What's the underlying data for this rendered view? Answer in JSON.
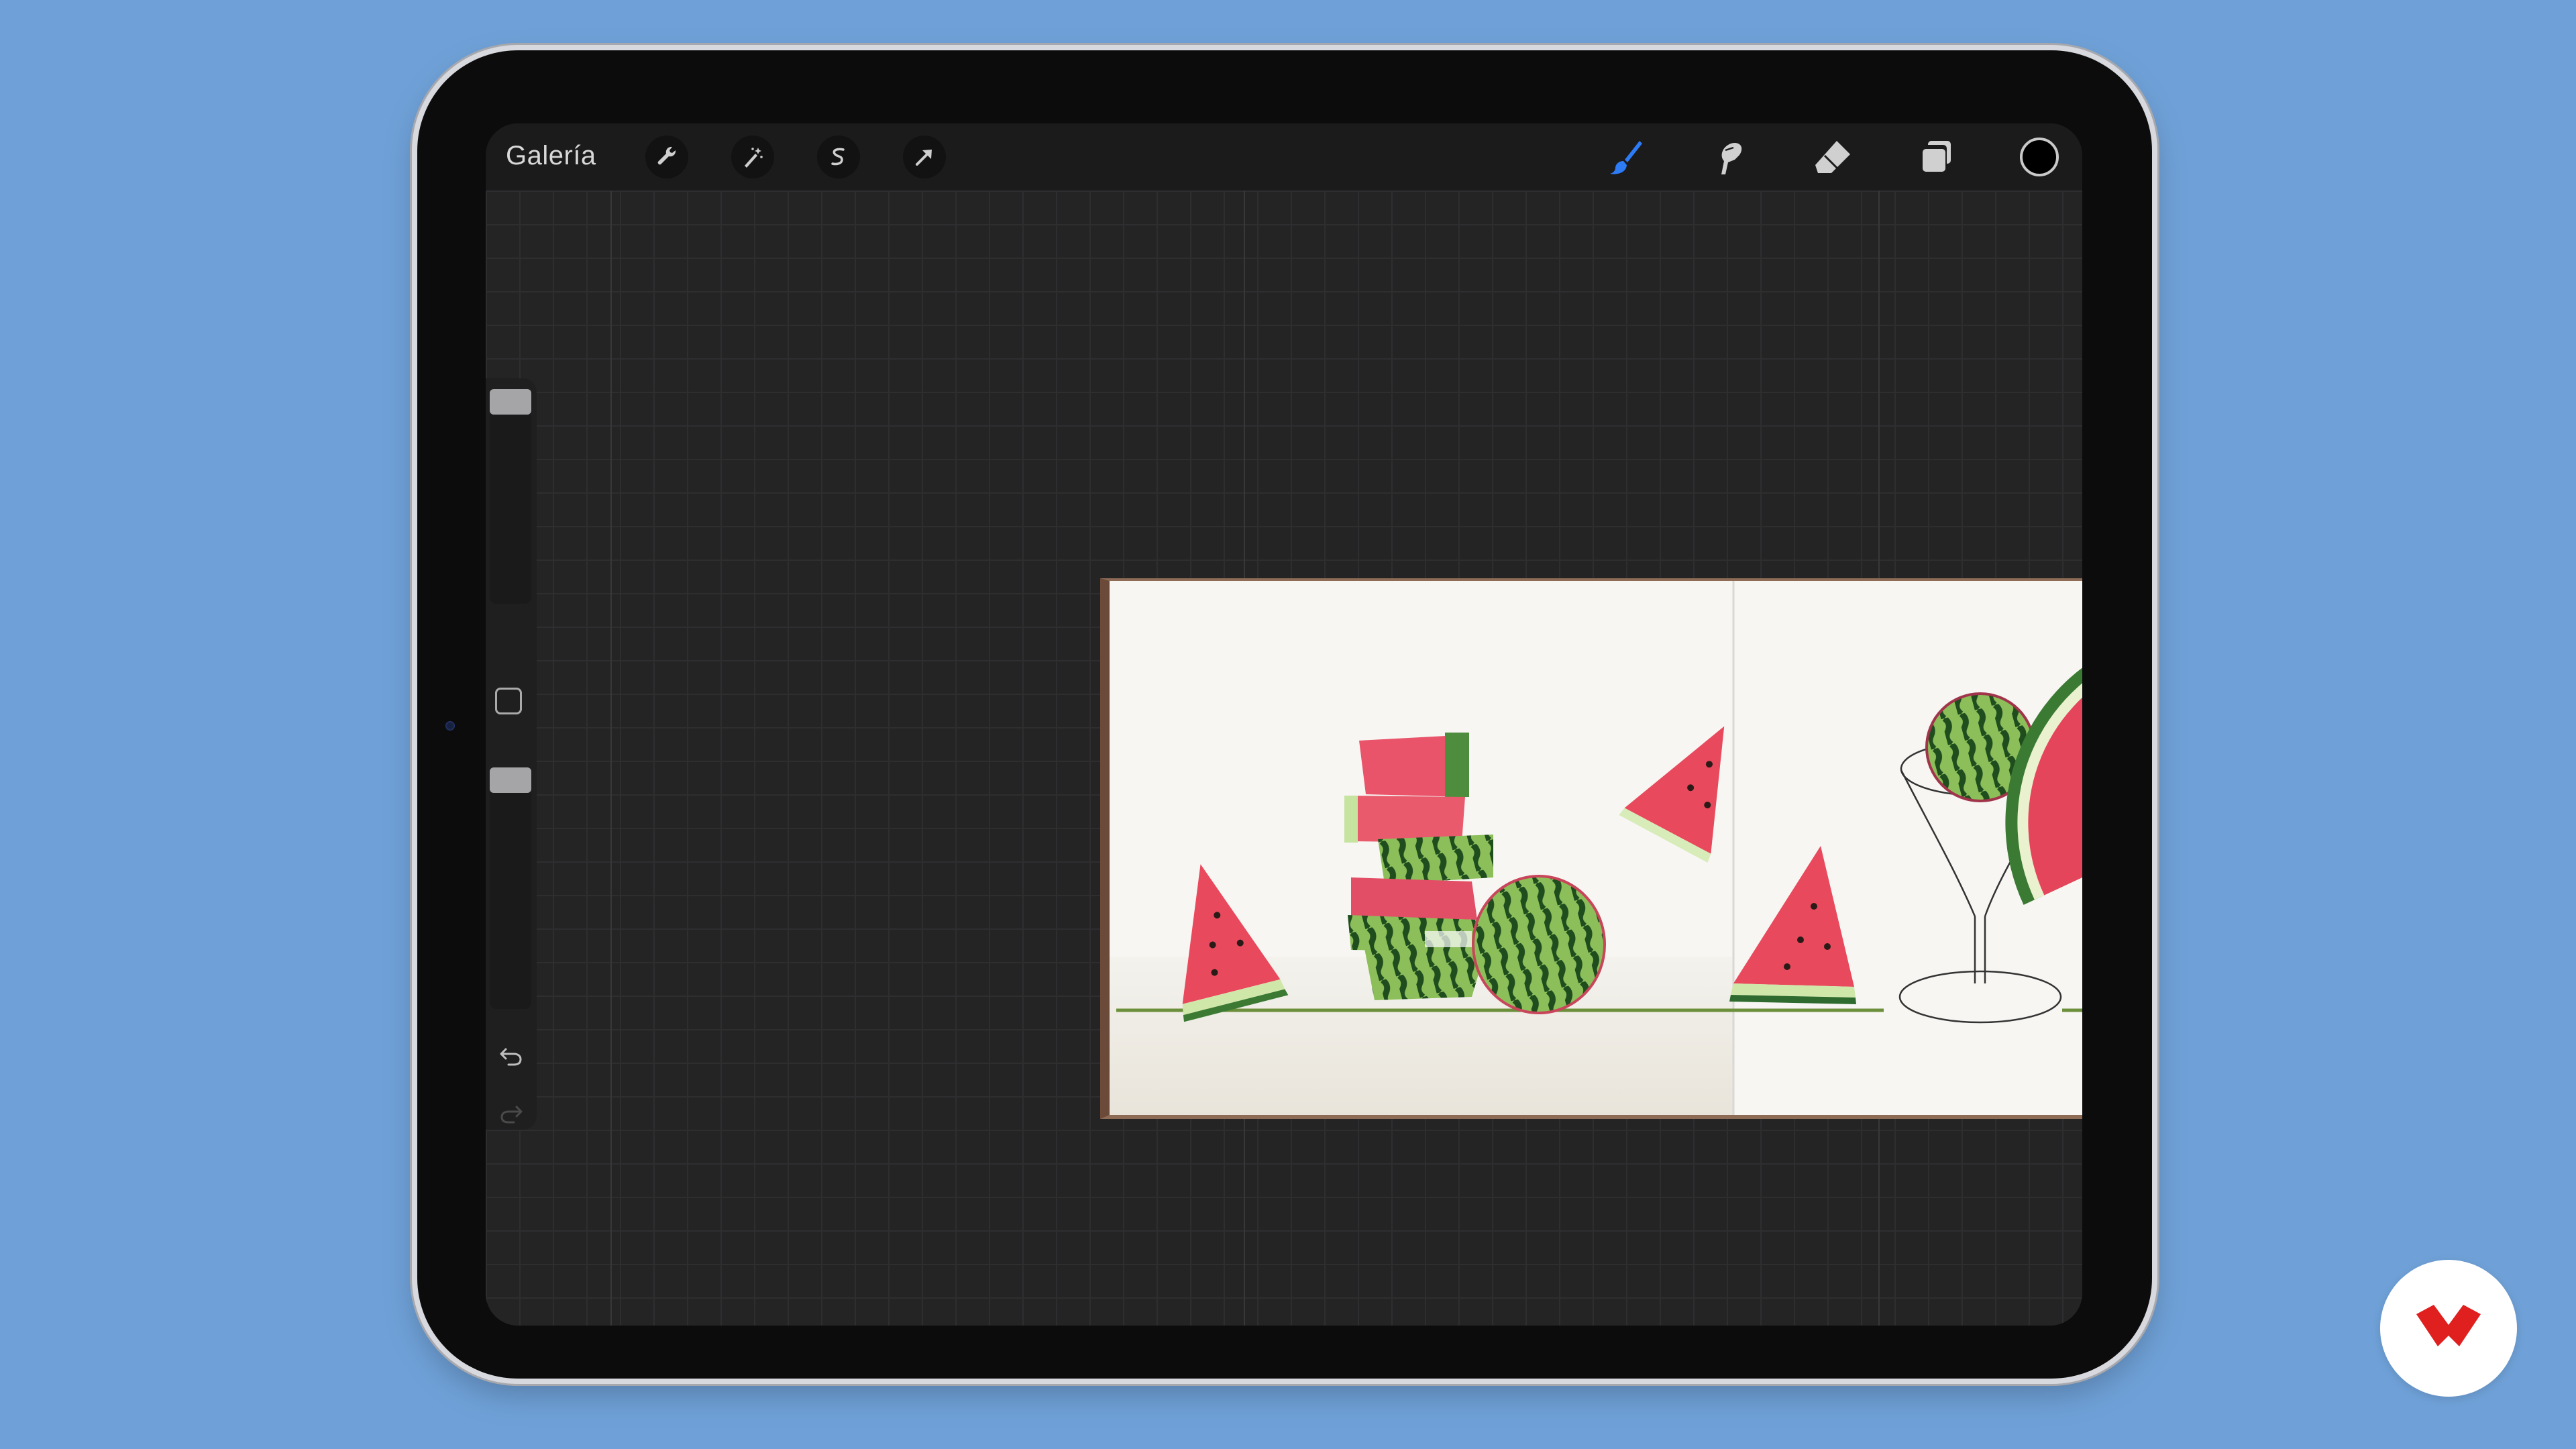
{
  "toolbar": {
    "gallery_label": "Galería",
    "left_tools": [
      "wrench-icon",
      "magic-wand-icon",
      "selection-icon",
      "transform-arrow-icon"
    ],
    "right_tools": [
      "brush-icon",
      "smudge-icon",
      "eraser-icon",
      "layers-icon",
      "color-swatch"
    ],
    "active_tool": "brush",
    "accent_color": "#2d7cf6",
    "current_color": "#000000"
  },
  "sidebar": {
    "brush_size_level": 0.0,
    "opacity_level": 0.0,
    "icons": [
      "modify-square-icon",
      "undo-icon",
      "redo-icon"
    ]
  },
  "brand": {
    "logo_color": "#e01f1f"
  }
}
